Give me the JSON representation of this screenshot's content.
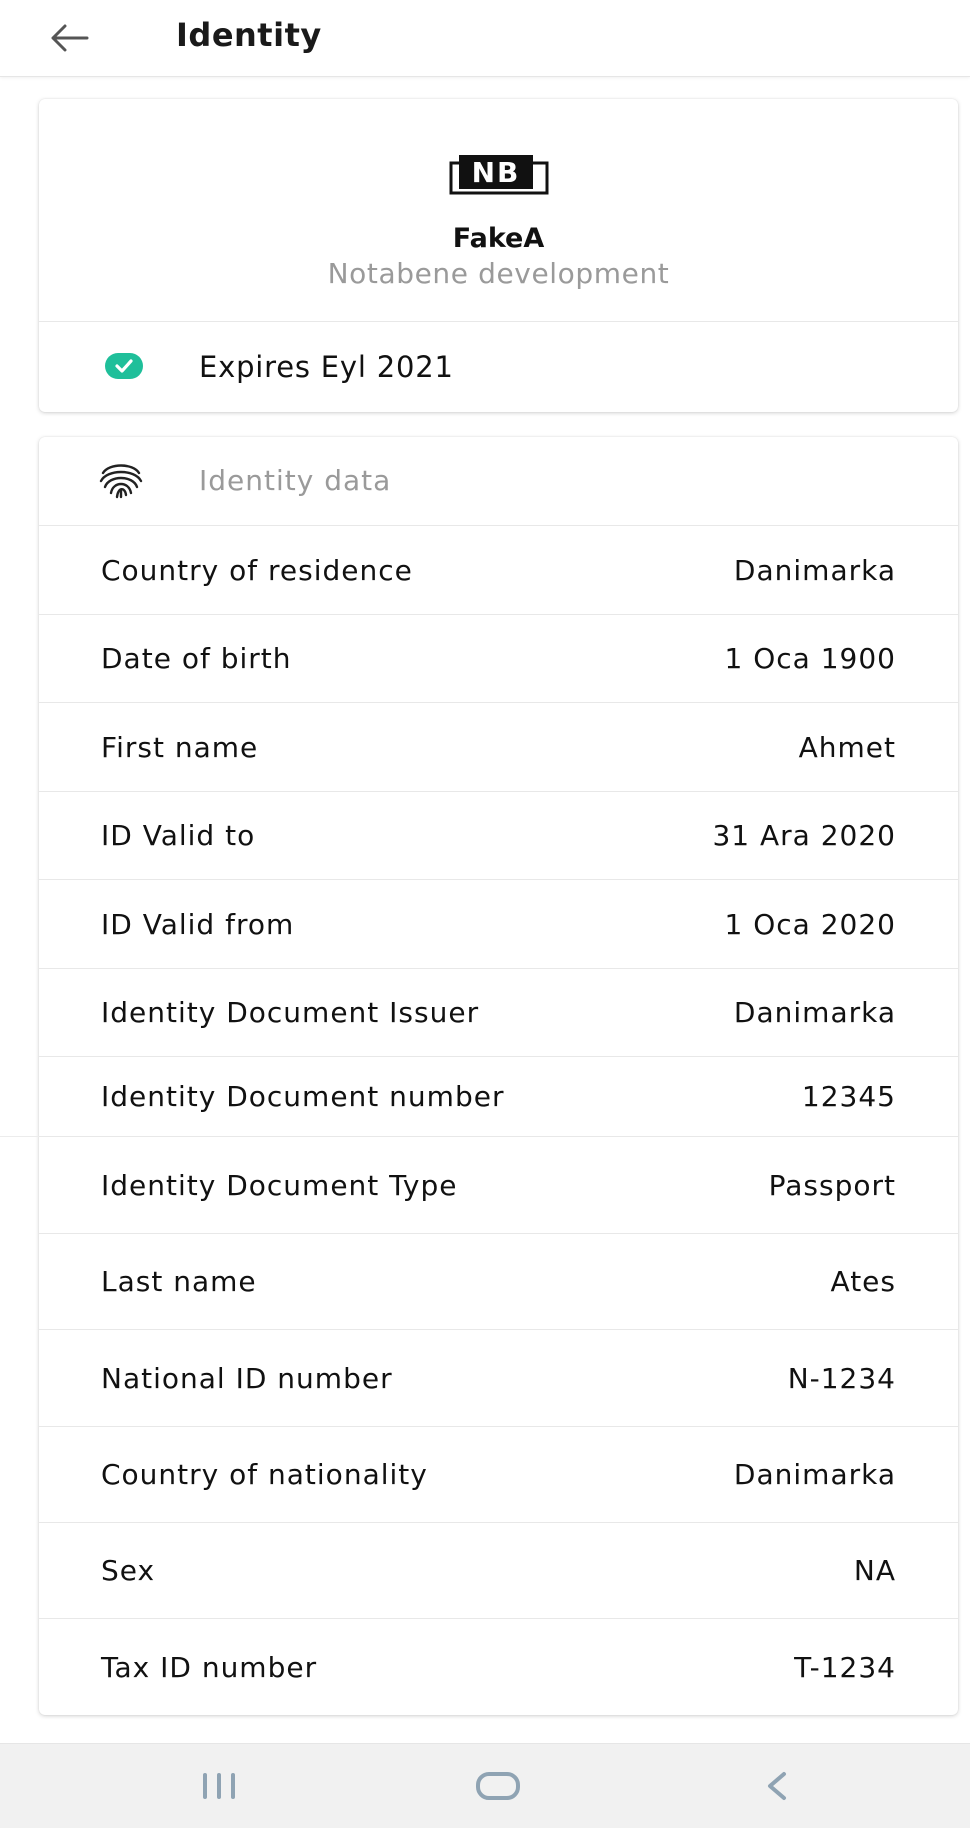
{
  "header": {
    "title": "Identity",
    "back_icon": "arrow-left-icon"
  },
  "organization": {
    "logo_text": "NB",
    "name": "FakeA",
    "subtitle": "Notabene development",
    "expiry_label": "Expires Eyl 2021",
    "status_color": "#1fbf9a"
  },
  "identity_data": {
    "section_title": "Identity data",
    "rows": [
      {
        "label": "Country of residence",
        "value": "Danimarka"
      },
      {
        "label": "Date of birth",
        "value": "1 Oca 1900"
      },
      {
        "label": "First name",
        "value": "Ahmet"
      },
      {
        "label": "ID Valid to",
        "value": "31 Ara 2020"
      },
      {
        "label": "ID Valid from",
        "value": "1 Oca 2020"
      },
      {
        "label": "Identity Document Issuer",
        "value": "Danimarka"
      },
      {
        "label": "Identity Document number",
        "value": "12345"
      },
      {
        "label": "Identity Document Type",
        "value": "Passport"
      },
      {
        "label": "Last name",
        "value": "Ates"
      },
      {
        "label": "National ID number",
        "value": "N-1234"
      },
      {
        "label": "Country of nationality",
        "value": "Danimarka"
      },
      {
        "label": "Sex",
        "value": "NA"
      },
      {
        "label": "Tax ID number",
        "value": "T-1234"
      }
    ]
  },
  "system_nav": {
    "recents_icon": "recents-icon",
    "home_icon": "home-icon",
    "back_icon": "chevron-left-icon"
  }
}
